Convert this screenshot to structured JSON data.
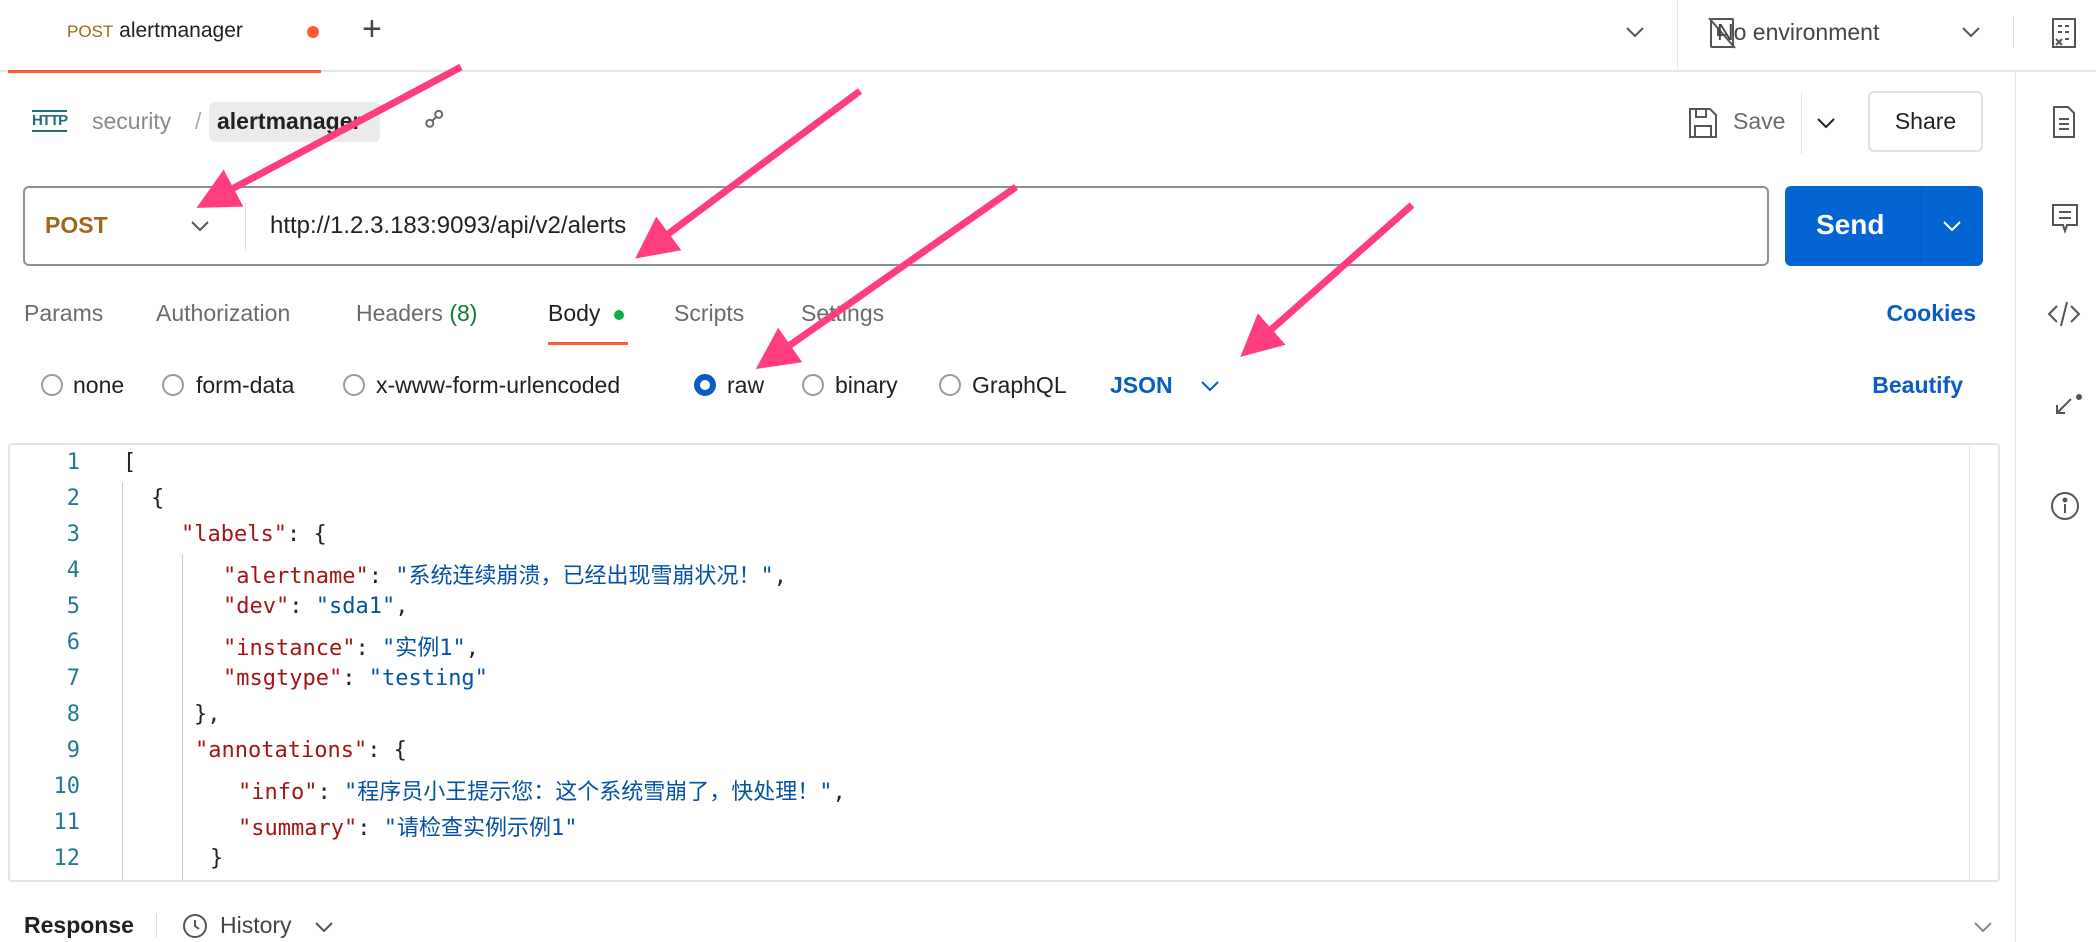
{
  "tab": {
    "method": "POST",
    "name": "alertmanager",
    "unsaved": true
  },
  "environment": {
    "label": "No environment"
  },
  "breadcrumb": {
    "icon": "http-icon",
    "collection": "security",
    "separator": "/",
    "request": "alertmanager"
  },
  "actions": {
    "save": "Save",
    "share": "Share"
  },
  "request": {
    "method": "POST",
    "url": "http://1.2.3.183:9093/api/v2/alerts",
    "send": "Send"
  },
  "tabs": [
    {
      "label": "Params"
    },
    {
      "label": "Authorization"
    },
    {
      "label": "Headers",
      "count": "(8)"
    },
    {
      "label": "Body",
      "active": true
    },
    {
      "label": "Scripts"
    },
    {
      "label": "Settings"
    }
  ],
  "cookies": "Cookies",
  "body_types": [
    {
      "label": "none"
    },
    {
      "label": "form-data"
    },
    {
      "label": "x-www-form-urlencoded"
    },
    {
      "label": "raw",
      "selected": true
    },
    {
      "label": "binary"
    },
    {
      "label": "GraphQL"
    }
  ],
  "format": "JSON",
  "beautify": "Beautify",
  "code_lines": [
    {
      "n": "1",
      "tokens": [
        [
          "p",
          "["
        ]
      ]
    },
    {
      "n": "2",
      "tokens": [
        [
          "p",
          "{"
        ]
      ]
    },
    {
      "n": "3",
      "tokens": [
        [
          "k",
          "\"labels\""
        ],
        [
          "p",
          ": {"
        ]
      ]
    },
    {
      "n": "4",
      "tokens": [
        [
          "k",
          "\"alertname\""
        ],
        [
          "p",
          ": "
        ],
        [
          "s",
          "\"系统连续崩溃，已经出现雪崩状况！\""
        ],
        [
          "p",
          ","
        ]
      ]
    },
    {
      "n": "5",
      "tokens": [
        [
          "k",
          "\"dev\""
        ],
        [
          "p",
          ": "
        ],
        [
          "s",
          "\"sda1\""
        ],
        [
          "p",
          ","
        ]
      ]
    },
    {
      "n": "6",
      "tokens": [
        [
          "k",
          "\"instance\""
        ],
        [
          "p",
          ": "
        ],
        [
          "s",
          "\"实例1\""
        ],
        [
          "p",
          ","
        ]
      ]
    },
    {
      "n": "7",
      "tokens": [
        [
          "k",
          "\"msgtype\""
        ],
        [
          "p",
          ": "
        ],
        [
          "s",
          "\"testing\""
        ]
      ]
    },
    {
      "n": "8",
      "tokens": [
        [
          "p",
          "},"
        ]
      ]
    },
    {
      "n": "9",
      "tokens": [
        [
          "k",
          "\"annotations\""
        ],
        [
          "p",
          ": {"
        ]
      ]
    },
    {
      "n": "10",
      "tokens": [
        [
          "k",
          "\"info\""
        ],
        [
          "p",
          ": "
        ],
        [
          "s",
          "\"程序员小王提示您：这个系统雪崩了，快处理！\""
        ],
        [
          "p",
          ","
        ]
      ]
    },
    {
      "n": "11",
      "tokens": [
        [
          "k",
          "\"summary\""
        ],
        [
          "p",
          ": "
        ],
        [
          "s",
          "\"请检查实例示例1\""
        ]
      ]
    },
    {
      "n": "12",
      "tokens": [
        [
          "p",
          "}"
        ]
      ]
    }
  ],
  "response": {
    "label": "Response",
    "history": "History"
  },
  "colors": {
    "accent": "#ff5c33",
    "send": "#0265d2",
    "method": "#a0671b",
    "annotation_arrow": "#ff3d7f",
    "key": "#a31515",
    "string": "#0451a5"
  }
}
